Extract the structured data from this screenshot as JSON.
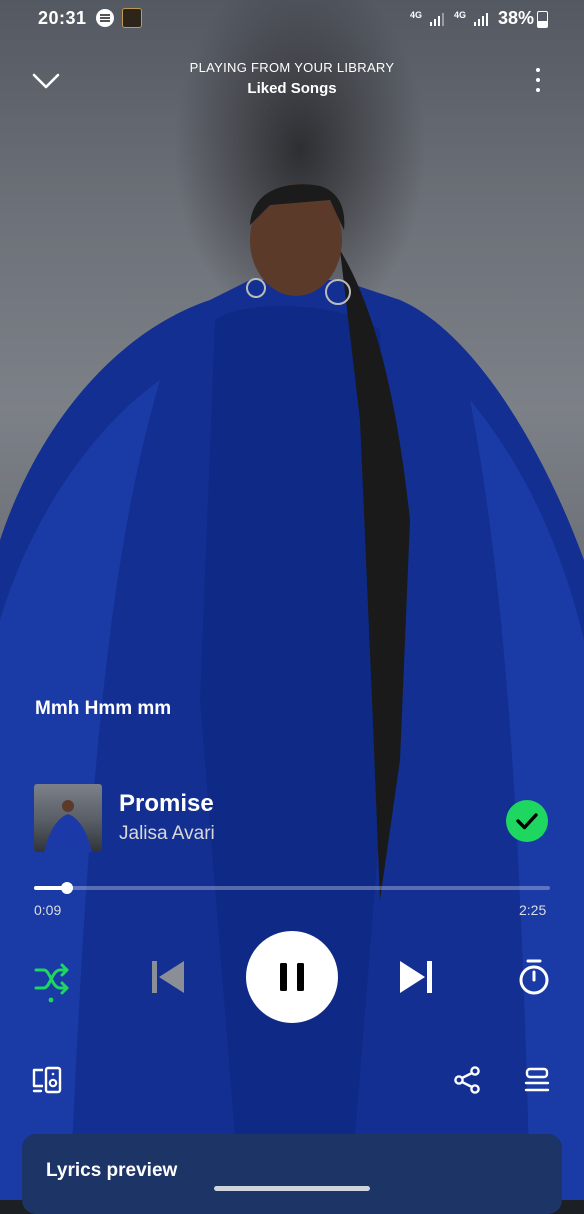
{
  "status_bar": {
    "time": "20:31",
    "network_1": "4G",
    "network_2": "4G",
    "battery": "38%"
  },
  "header": {
    "context_label": "PLAYING FROM YOUR LIBRARY",
    "context_name": "Liked Songs"
  },
  "lyric_line": "Mmh Hmm mm",
  "track": {
    "title": "Promise",
    "artist": "Jalisa Avari",
    "liked": true
  },
  "playback": {
    "elapsed": "0:09",
    "duration": "2:25",
    "progress_fraction": 0.064,
    "shuffle_on": true,
    "playing": true
  },
  "lyrics_card": {
    "title": "Lyrics preview"
  },
  "colors": {
    "accent_green": "#1ed760",
    "lyrics_card": "#1c3466",
    "coat_blue": "#1437a8"
  },
  "icons": [
    "chevron-down-icon",
    "more-options-icon",
    "check-icon",
    "shuffle-icon",
    "previous-icon",
    "pause-icon",
    "next-icon",
    "sleep-timer-icon",
    "devices-icon",
    "share-icon",
    "queue-icon"
  ]
}
